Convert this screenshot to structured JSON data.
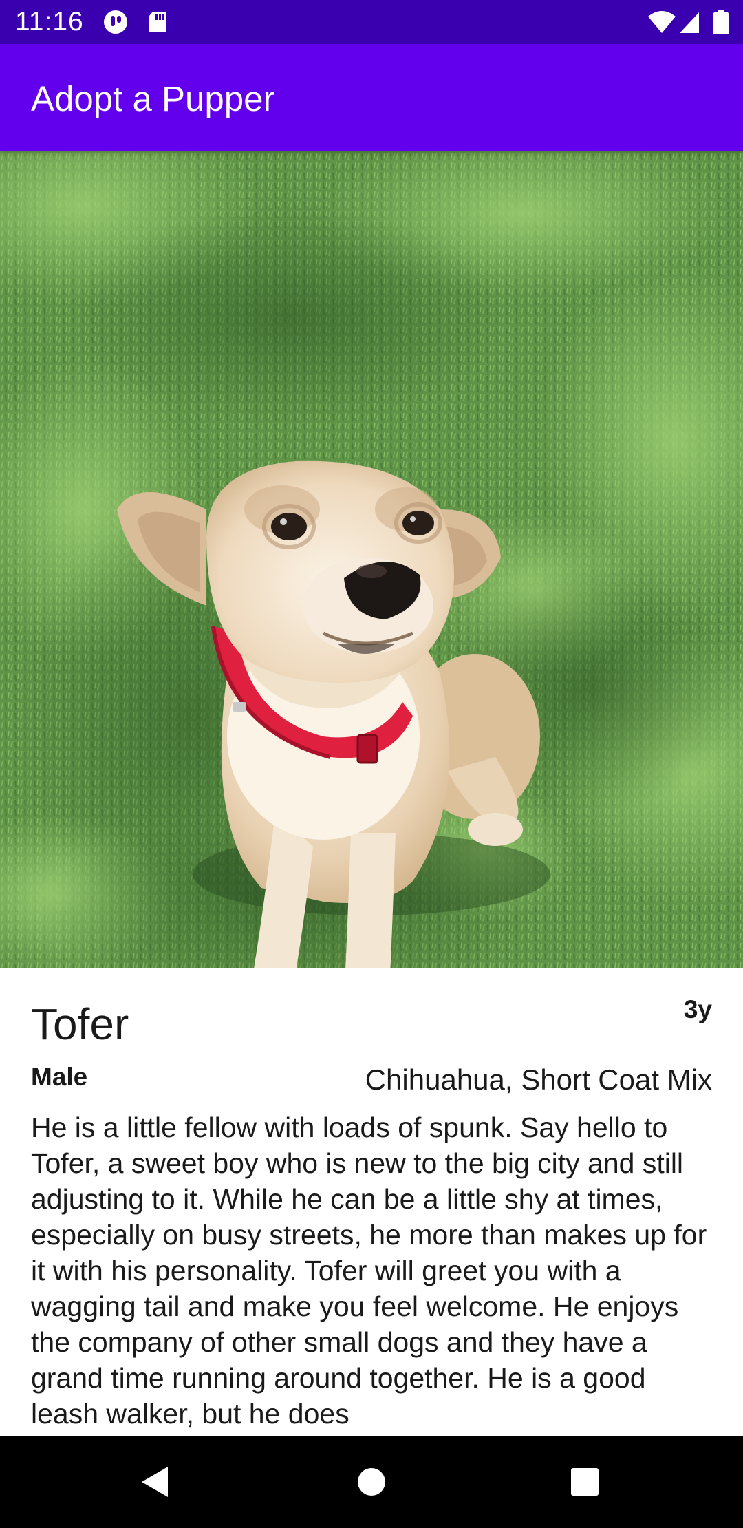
{
  "status_bar": {
    "time": "11:16",
    "notification_icons": [
      "app-notification-icon",
      "sd-card-icon"
    ],
    "system_icons": [
      "wifi-icon",
      "cell-signal-icon",
      "battery-icon"
    ]
  },
  "app_bar": {
    "title": "Adopt a Pupper",
    "color": "#6200ee"
  },
  "dog": {
    "photo_icon": "dog-photo",
    "name": "Tofer",
    "age": "3y",
    "gender": "Male",
    "breed": "Chihuahua, Short Coat Mix",
    "description": "He is a little fellow with loads of spunk. Say hello to Tofer, a sweet boy who is new to the big city and still adjusting to it. While he can be a little shy at times, especially on busy streets, he more than makes up for it with his personality. Tofer will greet you with a wagging tail and make you feel welcome. He enjoys the company of other small dogs and they have a grand time running around together. He is a good leash walker, but he does"
  },
  "nav_bar": {
    "buttons": [
      "back-icon",
      "home-icon",
      "recents-icon"
    ]
  },
  "colors": {
    "status_bar": "#3a00b0",
    "app_bar": "#6200ee",
    "nav_bar": "#000000",
    "text": "#1a1a1a"
  }
}
